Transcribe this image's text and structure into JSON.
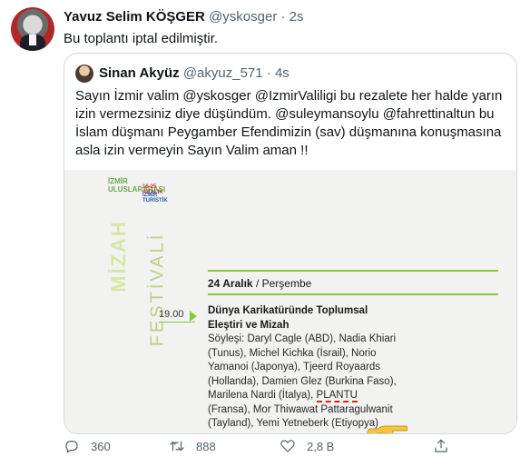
{
  "tweet": {
    "author_name": "Yavuz Selim KÖŞGER",
    "author_handle": "@yskosger",
    "separator": "·",
    "time": "2s",
    "text": "Bu toplantı iptal edilmiştir."
  },
  "quote": {
    "author_name": "Sinan Akyüz",
    "author_handle": "@akyuz_571",
    "separator": "·",
    "time": "4s",
    "text": "Sayın İzmir valim @yskosger @IzmirValiligi bu rezalete her halde yarın izin vermezsiniz diye düşündüm. @suleymansoylu @fahrettinaltun bu İslam düşmanı Peygamber Efendimizin (sav) düşmanına konuşmasına asla izin vermeyin Sayın Valim aman !!"
  },
  "poster": {
    "logo_lines": [
      "İZMİR",
      "ULUSLARARASI"
    ],
    "logo_date": "16-25 ARALIK",
    "logo_tag": "İZMİR TURİSTİK",
    "vertical_title": "MİZAH",
    "vertical_subtitle": "FESTİVALİ",
    "day": "24 Aralık",
    "weekday": "Perşembe",
    "time": "19.00",
    "session_title": "Dünya Karikatüründe Toplumsal Eleştiri ve Mizah",
    "speakers_intro": "Söyleşi:",
    "speakers_before": "Daryl Cagle (ABD), Nadia Khiari (Tunus), Michel Kichka (İsrail), Norio Yamanoi (Japonya), Tjeerd Royaards (Hollanda), Damien Glez (Burkina Faso), Marilena Nardi (İtalya),",
    "highlighted": "PLANTU",
    "speakers_after": "(Fransa), Mor Thiwawat Pattaragulwanit (Tayland), Yemi Yetneberk (Etiyopya)"
  },
  "actions": {
    "reply_count": "360",
    "retweet_count": "888",
    "like_count": "2,8 B",
    "icons": [
      "reply-icon",
      "retweet-icon",
      "like-icon",
      "share-icon"
    ]
  },
  "colors": {
    "festival_green": "#8dc63f",
    "muted_text": "#536471",
    "border": "#cfd9de"
  }
}
